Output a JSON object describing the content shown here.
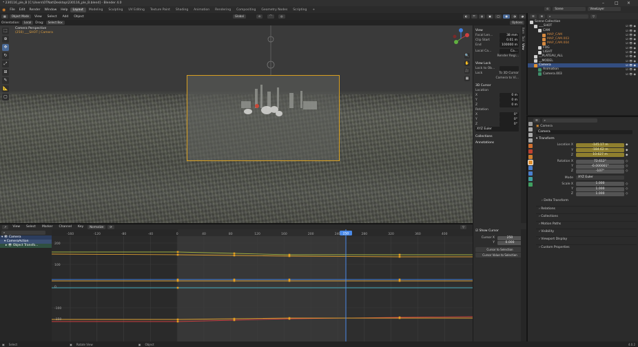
{
  "title": "* 230116_ple_B [C:\\Users\\OTNat\\Desktop\\230116_ple_B.blend] - Blender 4.0",
  "menus": [
    "File",
    "Edit",
    "Render",
    "Window",
    "Help"
  ],
  "workspaces": [
    "Layout",
    "Modeling",
    "Sculpting",
    "UV Editing",
    "Texture Paint",
    "Shading",
    "Animation",
    "Rendering",
    "Compositing",
    "Geometry Nodes",
    "Scripting"
  ],
  "active_workspace": "Layout",
  "viewport_header": {
    "mode": "Object Mode",
    "view": "View",
    "select": "Select",
    "add": "Add",
    "object": "Object",
    "transform_orientation": "Global",
    "options": "Options"
  },
  "viewport_tools": {
    "orientation_label": "Orientation:",
    "orientation": "Local",
    "drag_label": "Drag:",
    "drag": "Select Box"
  },
  "camera_overlay": {
    "line1": "Camera Perspective",
    "line2": "(250) ___SHOT | Camera"
  },
  "npanel": {
    "view_title": "View",
    "focal_label": "Focal Len...",
    "focal": "38 mm",
    "clip_start_label": "Clip Start",
    "clip_start": "0.01 m",
    "clip_end_label": "End",
    "clip_end": "100000 m",
    "local_cam_label": "Local Ca...",
    "local_cam": "Ca...",
    "render_region": "Render Regi...",
    "view_lock_title": "View Lock",
    "lock_obj_label": "Lock to Ob...",
    "lock_label": "Lock",
    "to_3d_cursor": "To 3D Cursor",
    "camera_to_view": "Camera to Vi...",
    "cursor_title": "3D Cursor",
    "location_label": "Location",
    "cx": "0 m",
    "cy": "0 m",
    "cz": "0 m",
    "rotation_label": "Rotation",
    "rx": "0°",
    "ry": "0°",
    "rz": "0°",
    "rot_mode": "XYZ Euler",
    "collections": "Collections",
    "annotations": "Annotations"
  },
  "npanel_tabs": [
    "Item",
    "Tool",
    "View"
  ],
  "outliner": {
    "scene": "Scene",
    "viewlayer": "ViewLayer",
    "items": [
      {
        "label": "Scene Collection",
        "indent": 0,
        "color": "#d0d0d0"
      },
      {
        "label": "___SHOT",
        "indent": 1,
        "color": "#d0d0d0"
      },
      {
        "label": "CAM",
        "indent": 2,
        "color": "#d0d0d0"
      },
      {
        "label": "MAP_CAM",
        "indent": 3,
        "color": "#d68a40"
      },
      {
        "label": "MAP_CAM.003",
        "indent": 3,
        "color": "#d68a40"
      },
      {
        "label": "MAP_CAM.004",
        "indent": 3,
        "color": "#d68a40"
      },
      {
        "label": "FOG",
        "indent": 2,
        "color": "#d0d0d0"
      },
      {
        "label": "LIGHT",
        "indent": 2,
        "color": "#d0d0d0"
      },
      {
        "label": "__PLATEAU_ALL",
        "indent": 1,
        "color": "#d0d0d0"
      },
      {
        "label": "__MODEL",
        "indent": 1,
        "color": "#d0d0d0"
      },
      {
        "label": "Camera",
        "indent": 1,
        "color": "#ffffff",
        "selected": true
      },
      {
        "label": "Animation",
        "indent": 2,
        "color": "#d0d0d0"
      },
      {
        "label": "Camera.003",
        "indent": 2,
        "color": "#d0d0d0"
      }
    ]
  },
  "properties": {
    "object_name": "Camera",
    "name_field": "Camera",
    "transform_title": "Transform",
    "location_x_label": "Location X",
    "location_x": "-145.17 m",
    "location_y": "-184.62 m",
    "location_z": "10.627 m",
    "rotation_x_label": "Rotation X",
    "rotation_x": "72.612°",
    "rotation_y": "-0.000001°",
    "rotation_z": "-107°",
    "mode_label": "Mode",
    "mode": "XYZ Euler",
    "scale_x_label": "Scale X",
    "scale_x": "1.000",
    "scale_y": "1.000",
    "scale_z": "1.000",
    "y_label": "Y",
    "z_label": "Z",
    "delta_transform": "Delta Transform",
    "sections": [
      "Relations",
      "Collections",
      "Motion Paths",
      "Visibility",
      "Viewport Display",
      "Custom Properties"
    ]
  },
  "graph_editor": {
    "menus": [
      "View",
      "Select",
      "Marker",
      "Channel",
      "Key"
    ],
    "normalize": "Normalize",
    "channels": [
      "Camera",
      "CameraAction",
      "Object Transfo..."
    ],
    "frame_ticks": [
      "-160",
      "-120",
      "-80",
      "-40",
      "0",
      "40",
      "80",
      "120",
      "160",
      "200",
      "240",
      "280",
      "320",
      "360",
      "400"
    ],
    "current_frame": "250",
    "value_ticks": [
      "200",
      "100",
      "0",
      "-100",
      "-150"
    ],
    "show_cursor": "Show Cursor",
    "cursor_x_label": "Cursor X",
    "cursor_x": "250",
    "cursor_y_label": "Y",
    "cursor_y": "0.000",
    "cursor_to_selection": "Cursor to Selection",
    "cursor_value_to_selection": "Cursor Value to Selection"
  },
  "status": {
    "select": "Select",
    "rotate": "Rotate View",
    "object": "Object",
    "version": "4.0.2"
  }
}
